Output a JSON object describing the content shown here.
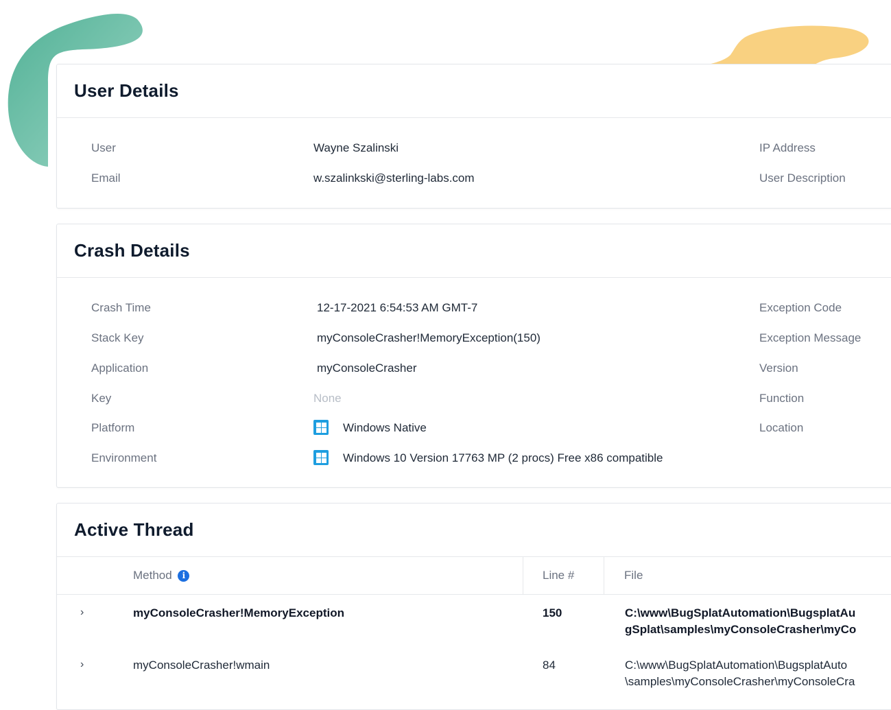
{
  "user_details": {
    "title": "User Details",
    "fields": [
      {
        "label": "User",
        "value": "Wayne Szalinski"
      },
      {
        "label": "Email",
        "value": "w.szalinkski@sterling-labs.com"
      }
    ],
    "right_labels": [
      "IP Address",
      "User Description"
    ]
  },
  "crash_details": {
    "title": "Crash Details",
    "fields": [
      {
        "label": "Crash Time",
        "value": "12-17-2021 6:54:53 AM GMT-7"
      },
      {
        "label": "Stack Key",
        "value": "myConsoleCrasher!MemoryException(150)"
      },
      {
        "label": "Application",
        "value": "myConsoleCrasher"
      },
      {
        "label": "Key",
        "value": "None"
      },
      {
        "label": "Platform",
        "value": "Windows Native",
        "icon": "windows-icon"
      },
      {
        "label": "Environment",
        "value": "Windows 10 Version 17763 MP (2 procs) Free x86 compatible",
        "icon": "windows-icon"
      }
    ],
    "right_labels": [
      "Exception Code",
      "Exception Message",
      "Version",
      "Function",
      "Location"
    ]
  },
  "active_thread": {
    "title": "Active Thread",
    "columns": {
      "method": "Method",
      "line": "Line #",
      "file": "File"
    },
    "info_icon": "i",
    "rows": [
      {
        "method": "myConsoleCrasher!MemoryException",
        "line": "150",
        "file_line1": "C:\\www\\BugSplatAutomation\\BugsplatAu",
        "file_line2": "gSplat\\samples\\myConsoleCrasher\\myCo"
      },
      {
        "method": "myConsoleCrasher!wmain",
        "line": "84",
        "file_line1": "C:\\www\\BugSplatAutomation\\BugsplatAuto",
        "file_line2": "\\samples\\myConsoleCrasher\\myConsoleCra"
      }
    ]
  },
  "colors": {
    "teal_blob": "#5fb8a0",
    "yellow_blob": "#f9cf7a",
    "windows_blue": "#1e9ee0",
    "info_blue": "#1c6fe0"
  }
}
